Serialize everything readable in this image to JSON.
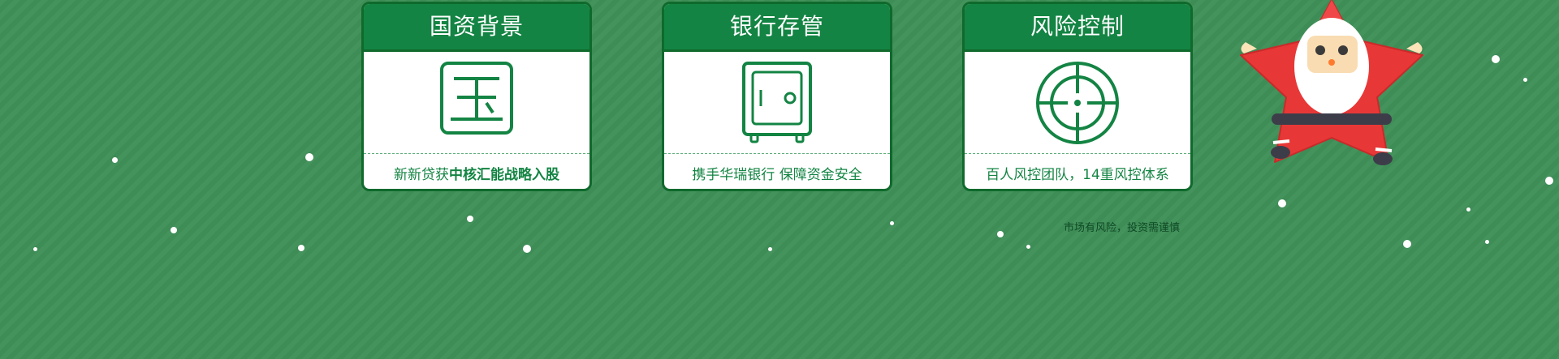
{
  "cards": [
    {
      "title": "国资背景",
      "desc_plain": "新新贷获",
      "desc_bold": "中核汇能战略入股",
      "icon": "jade-character-icon"
    },
    {
      "title": "银行存管",
      "desc_plain": "携手华瑞银行 保障资金安全",
      "desc_bold": "",
      "icon": "safe-icon"
    },
    {
      "title": "风险控制",
      "desc_plain": "百人风控团队，14重风控体系",
      "desc_bold": "",
      "icon": "target-icon"
    }
  ],
  "notice": "市场有风险，投资需谨慎",
  "decoration": {
    "santa": "santa-star-icon"
  },
  "colors": {
    "background": "#3f8f58",
    "card_header": "#138443",
    "card_border": "#0f6a2c",
    "text_accent": "#138443"
  }
}
